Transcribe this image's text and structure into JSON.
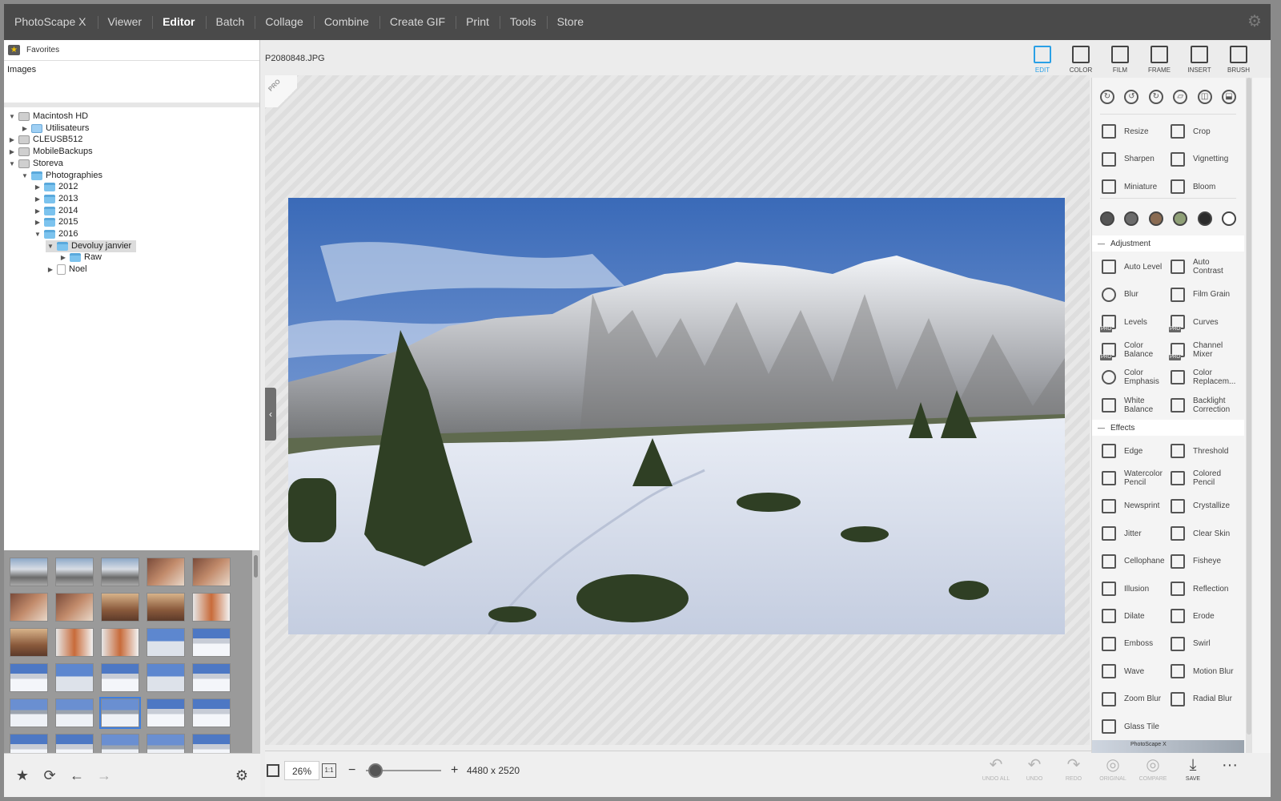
{
  "app": {
    "brand": "PhotoScape X",
    "nav": [
      "Viewer",
      "Editor",
      "Batch",
      "Collage",
      "Combine",
      "Create GIF",
      "Print",
      "Tools",
      "Store"
    ],
    "active_nav": "Editor"
  },
  "left": {
    "favorites": "Favorites",
    "images_label": "Images",
    "tree": [
      {
        "label": "Macintosh HD",
        "level": 0,
        "expanded": true,
        "icon": "drive"
      },
      {
        "label": "Utilisateurs",
        "level": 1,
        "expanded": false,
        "icon": "user"
      },
      {
        "label": "CLEUSB512",
        "level": 0,
        "expanded": false,
        "icon": "drive"
      },
      {
        "label": "MobileBackups",
        "level": 0,
        "expanded": false,
        "icon": "drive"
      },
      {
        "label": "Storeva",
        "level": 0,
        "expanded": true,
        "icon": "drive"
      },
      {
        "label": "Photographies",
        "level": 1,
        "expanded": true,
        "icon": "folder"
      },
      {
        "label": "2012",
        "level": 2,
        "expanded": false,
        "icon": "folder"
      },
      {
        "label": "2013",
        "level": 2,
        "expanded": false,
        "icon": "folder"
      },
      {
        "label": "2014",
        "level": 2,
        "expanded": false,
        "icon": "folder"
      },
      {
        "label": "2015",
        "level": 2,
        "expanded": false,
        "icon": "folder"
      },
      {
        "label": "2016",
        "level": 2,
        "expanded": true,
        "icon": "folder"
      },
      {
        "label": "Devoluy janvier",
        "level": 3,
        "expanded": true,
        "icon": "folder",
        "selected": true
      },
      {
        "label": "Raw",
        "level": 4,
        "expanded": false,
        "icon": "folder"
      },
      {
        "label": "Noel",
        "level": 3,
        "expanded": false,
        "icon": "doc"
      }
    ],
    "thumb_rows": [
      [
        "t-cloud",
        "t-cloud",
        "t-cloud",
        "t-room",
        "t-room"
      ],
      [
        "t-room",
        "t-room",
        "t-room2",
        "t-room2",
        "t-hall"
      ],
      [
        "t-room2",
        "t-hall",
        "t-hall",
        "t-port",
        "t-snow"
      ],
      [
        "t-snow",
        "t-port",
        "t-snow",
        "t-port",
        "t-snow"
      ],
      [
        "t-snow2",
        "t-snow2",
        "t-snow2",
        "t-snow",
        "t-snow"
      ],
      [
        "t-snow",
        "t-snow",
        "t-snow2",
        "t-snow2",
        "t-snow"
      ]
    ],
    "selected_thumb": "4-2"
  },
  "editor": {
    "filename": "P2080848.JPG",
    "pro_badge": "PRO",
    "zoom": "26%",
    "one_to_one": "1:1",
    "zoom_minus": "−",
    "zoom_plus": "+",
    "dimensions": "4480 x 2520",
    "actions": [
      {
        "label": "UNDO ALL",
        "glyph": "↶",
        "enabled": false
      },
      {
        "label": "UNDO",
        "glyph": "↶",
        "enabled": false
      },
      {
        "label": "REDO",
        "glyph": "↷",
        "enabled": false
      },
      {
        "label": "ORIGINAL",
        "glyph": "◎",
        "enabled": false
      },
      {
        "label": "COMPARE",
        "glyph": "◎",
        "enabled": false
      },
      {
        "label": "SAVE",
        "glyph": "⤓",
        "enabled": true
      },
      {
        "label": "",
        "glyph": "···",
        "enabled": true
      }
    ]
  },
  "right": {
    "tabs": [
      {
        "label": "EDIT",
        "active": true
      },
      {
        "label": "COLOR"
      },
      {
        "label": "FILM"
      },
      {
        "label": "FRAME"
      },
      {
        "label": "INSERT"
      },
      {
        "label": "BRUSH"
      }
    ],
    "rotate_icons": [
      "rotate-cw-icon",
      "rotate-ccw-icon",
      "rotate-custom-icon",
      "straighten-icon",
      "flip-horizontal-icon",
      "flip-vertical-icon"
    ],
    "basic_tools": [
      [
        "Resize",
        "Crop"
      ],
      [
        "Sharpen",
        "Vignetting"
      ],
      [
        "Miniature",
        "Bloom"
      ]
    ],
    "swatches": [
      "#555555",
      "#6b6b6b",
      "#8a6b52",
      "#8fa077",
      "#2b2b2b",
      "#ffffff"
    ],
    "sections": {
      "adjustment": {
        "title": "Adjustment",
        "tools": [
          [
            "Auto Level",
            "Auto\nContrast"
          ],
          [
            "Blur",
            "Film Grain"
          ],
          [
            "Levels",
            "Curves"
          ],
          [
            "Color\nBalance",
            "Channel\nMixer"
          ],
          [
            "Color\nEmphasis",
            "Color\nReplacem..."
          ],
          [
            "White\nBalance",
            "Backlight\nCorrection"
          ]
        ],
        "pro": [
          "Levels",
          "Curves",
          "Color\nBalance",
          "Channel\nMixer"
        ]
      },
      "effects": {
        "title": "Effects",
        "tools": [
          [
            "Edge",
            "Threshold"
          ],
          [
            "Watercolor\nPencil",
            "Colored\nPencil"
          ],
          [
            "Newsprint",
            "Crystallize"
          ],
          [
            "Jitter",
            "Clear Skin"
          ],
          [
            "Cellophane",
            "Fisheye"
          ],
          [
            "Illusion",
            "Reflection"
          ],
          [
            "Dilate",
            "Erode"
          ],
          [
            "Emboss",
            "Swirl"
          ],
          [
            "Wave",
            "Motion Blur"
          ],
          [
            "Zoom Blur",
            "Radial Blur"
          ],
          [
            "Glass Tile",
            ""
          ]
        ]
      }
    },
    "mini_preview": "PhotoScape X"
  },
  "colors": {
    "accent": "#2aa0e6",
    "topbar": "#4a4a4a",
    "selection": "#3f7fe0"
  }
}
